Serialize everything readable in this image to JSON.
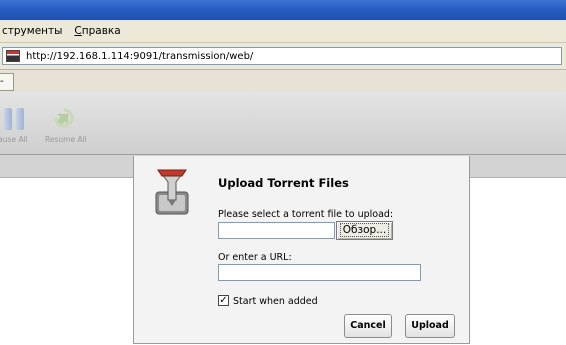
{
  "menubar": {
    "items": [
      {
        "label": "струменты"
      },
      {
        "accel": "С",
        "rest": "правка"
      }
    ]
  },
  "address": {
    "url": "http://192.168.1.114:9091/transmission/web/"
  },
  "tab": {
    "label": "-"
  },
  "toolbar": {
    "pause_all_label": "Pause All",
    "resume_all_label": "Resume All",
    "disabled_color": "#9a9a9a"
  },
  "dialog": {
    "title": "Upload Torrent Files",
    "file_prompt": "Please select a torrent file to upload:",
    "file_value": "",
    "browse_label": "Обзор...",
    "url_prompt": "Or enter a URL:",
    "url_value": "",
    "start_when_added_label": "Start when added",
    "start_when_added_checked": true,
    "checkmark": "✓",
    "cancel_label": "Cancel",
    "upload_label": "Upload"
  }
}
